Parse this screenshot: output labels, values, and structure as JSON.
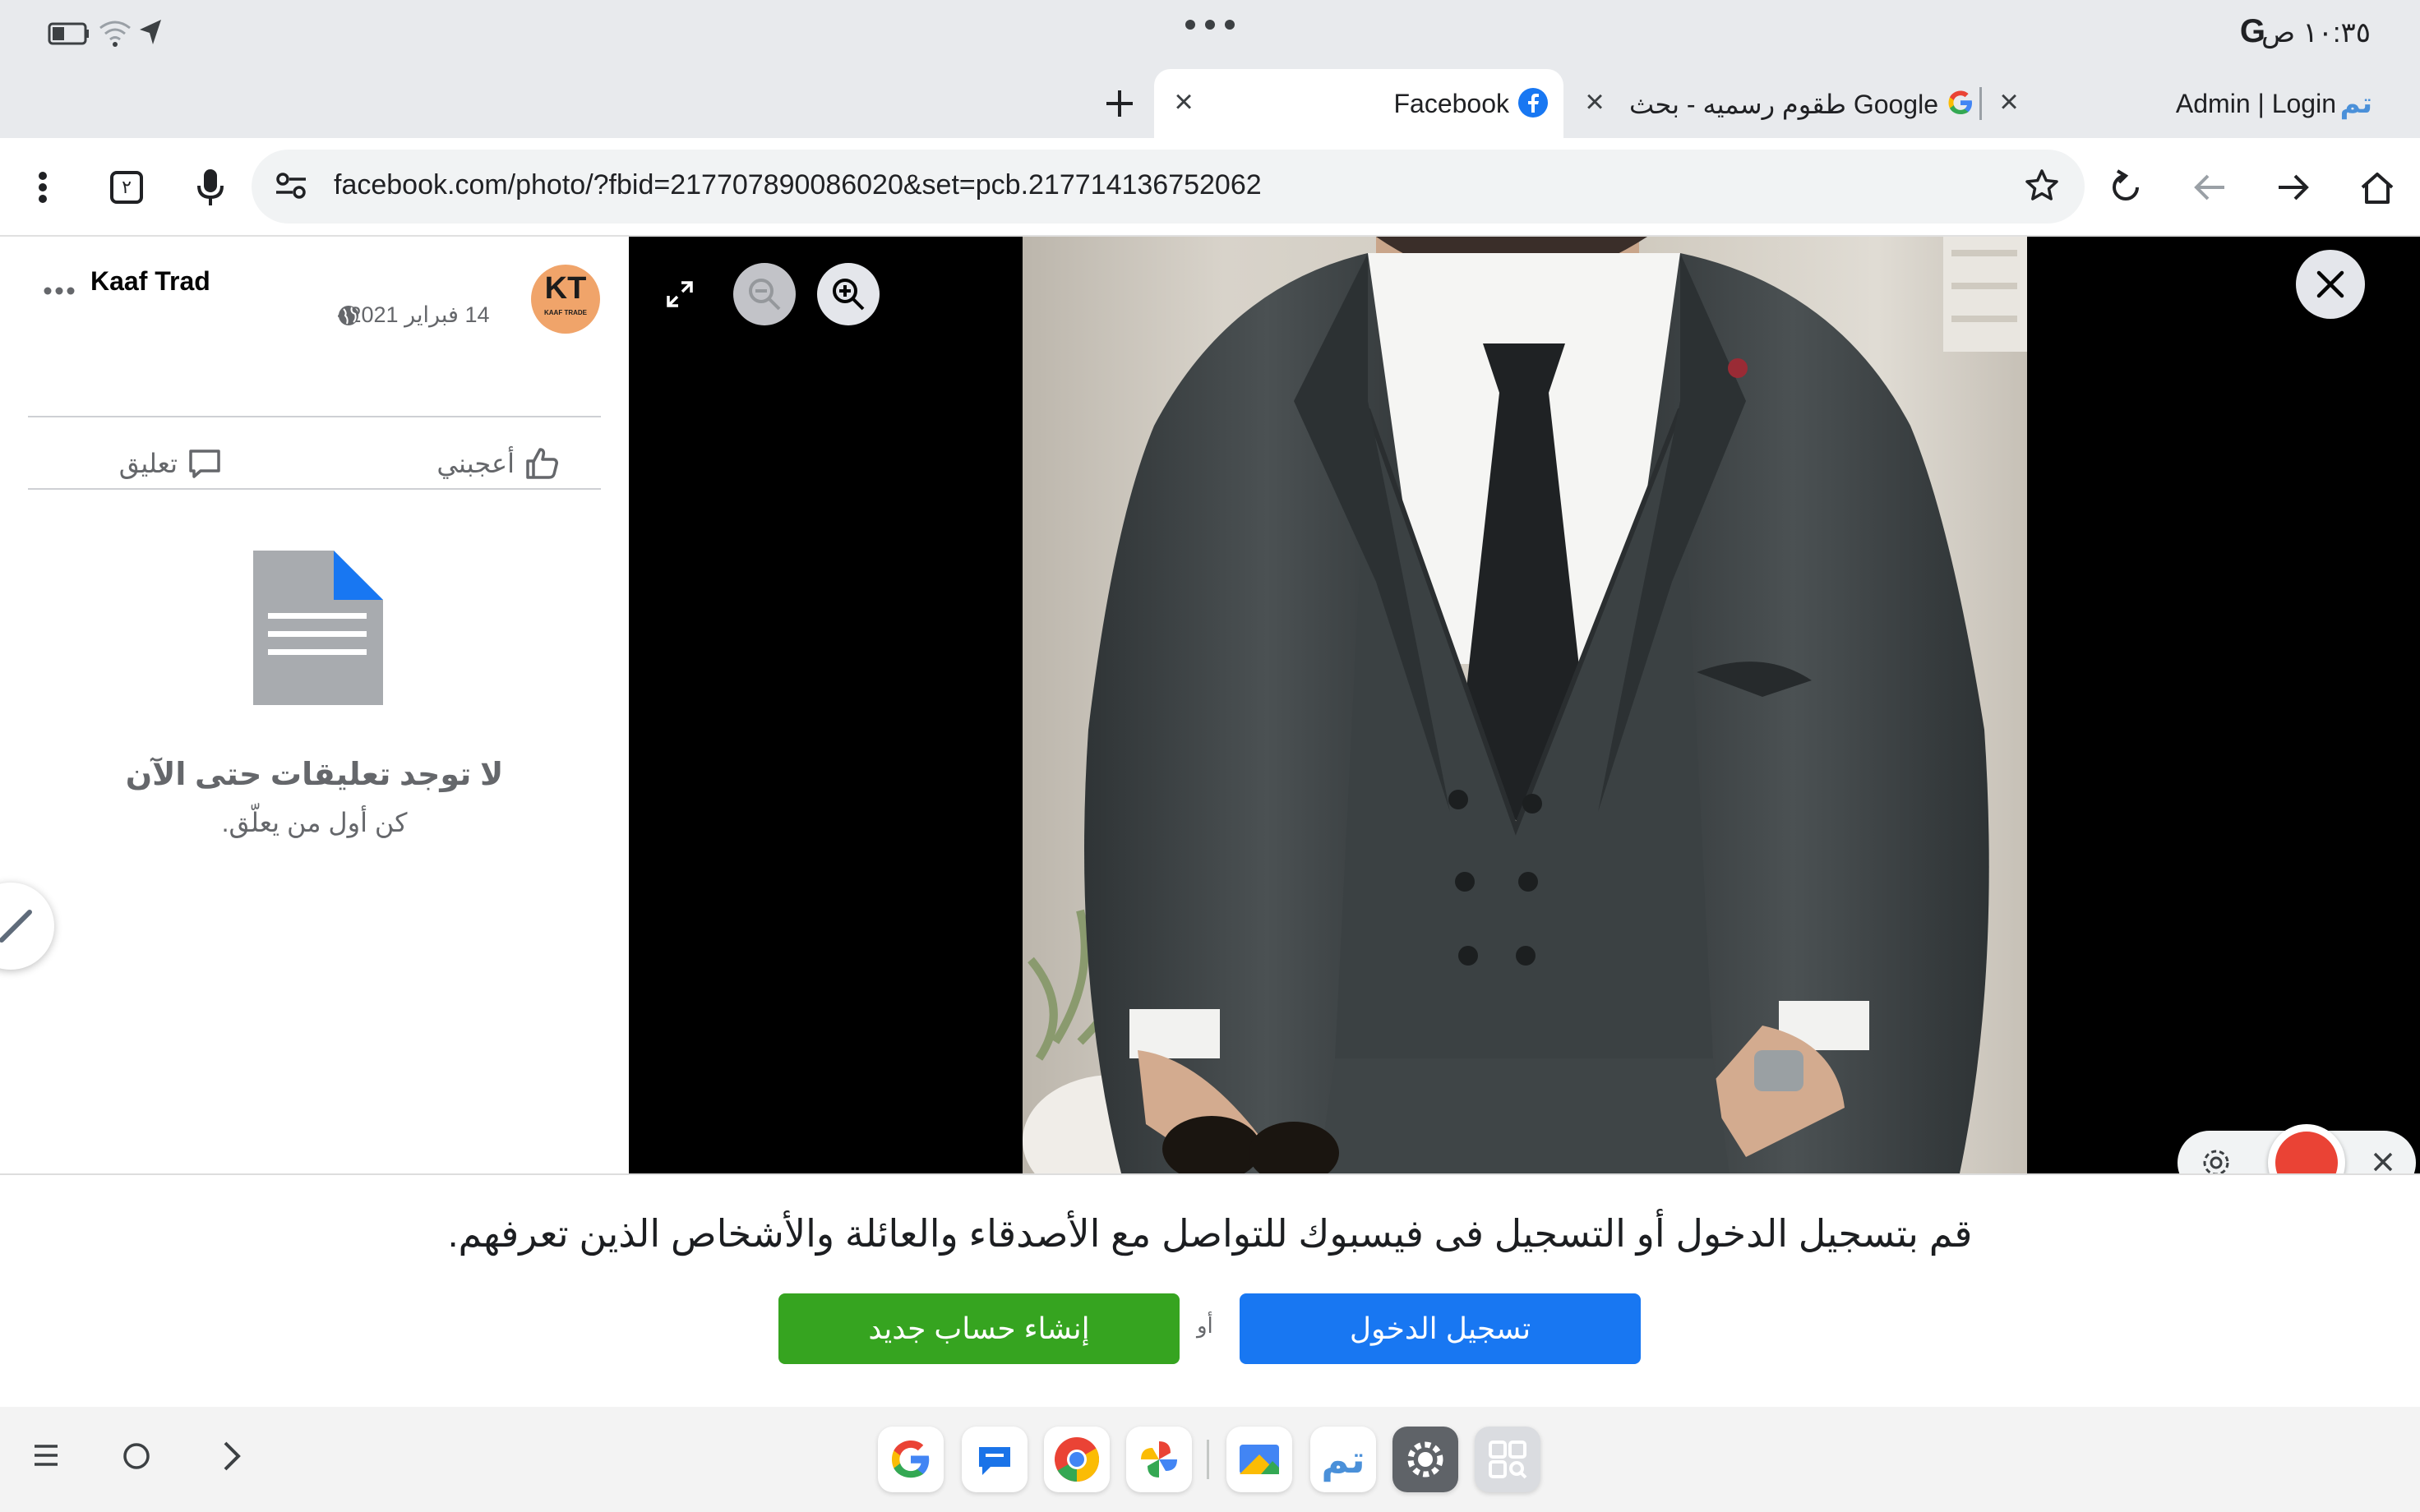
{
  "status_bar": {
    "time": "١٠:٣٥ ص",
    "g_label": "G"
  },
  "tabs": [
    {
      "label": "Admin | Login",
      "favicon": "tam-logo-icon"
    },
    {
      "label": "طقوم رسميه - بحث Google",
      "favicon": "google-icon"
    },
    {
      "label": "Facebook",
      "favicon": "facebook-icon",
      "active": true
    }
  ],
  "toolbar": {
    "url": "facebook.com/photo/?fbid=217707890086020&set=pcb.217714136752062",
    "tab_count": "٢"
  },
  "post": {
    "author": "Kaaf Trad",
    "avatar_text": "KT",
    "avatar_subtext": "KAAF TRADE",
    "date": "14 فبراير 2021 ·",
    "like_label": "أعجبني",
    "comment_label": "تعليق",
    "no_comments_title": "لا توجد تعليقات حتى الآن",
    "no_comments_subtitle": "كن أول من يعلّق."
  },
  "banner": {
    "text": "قم بتسجيل الدخول أو التسجيل فى فيسبوك للتواصل مع الأصدقاء والعائلة والأشخاص الذين تعرفهم.",
    "login_label": "تسجيل الدخول",
    "or_label": "أو",
    "create_label": "إنشاء حساب جديد",
    "login_color": "#1877f2",
    "create_color": "#36a420"
  },
  "colors": {
    "chrome_bg": "#e8eaed",
    "record": "#ea4335"
  }
}
